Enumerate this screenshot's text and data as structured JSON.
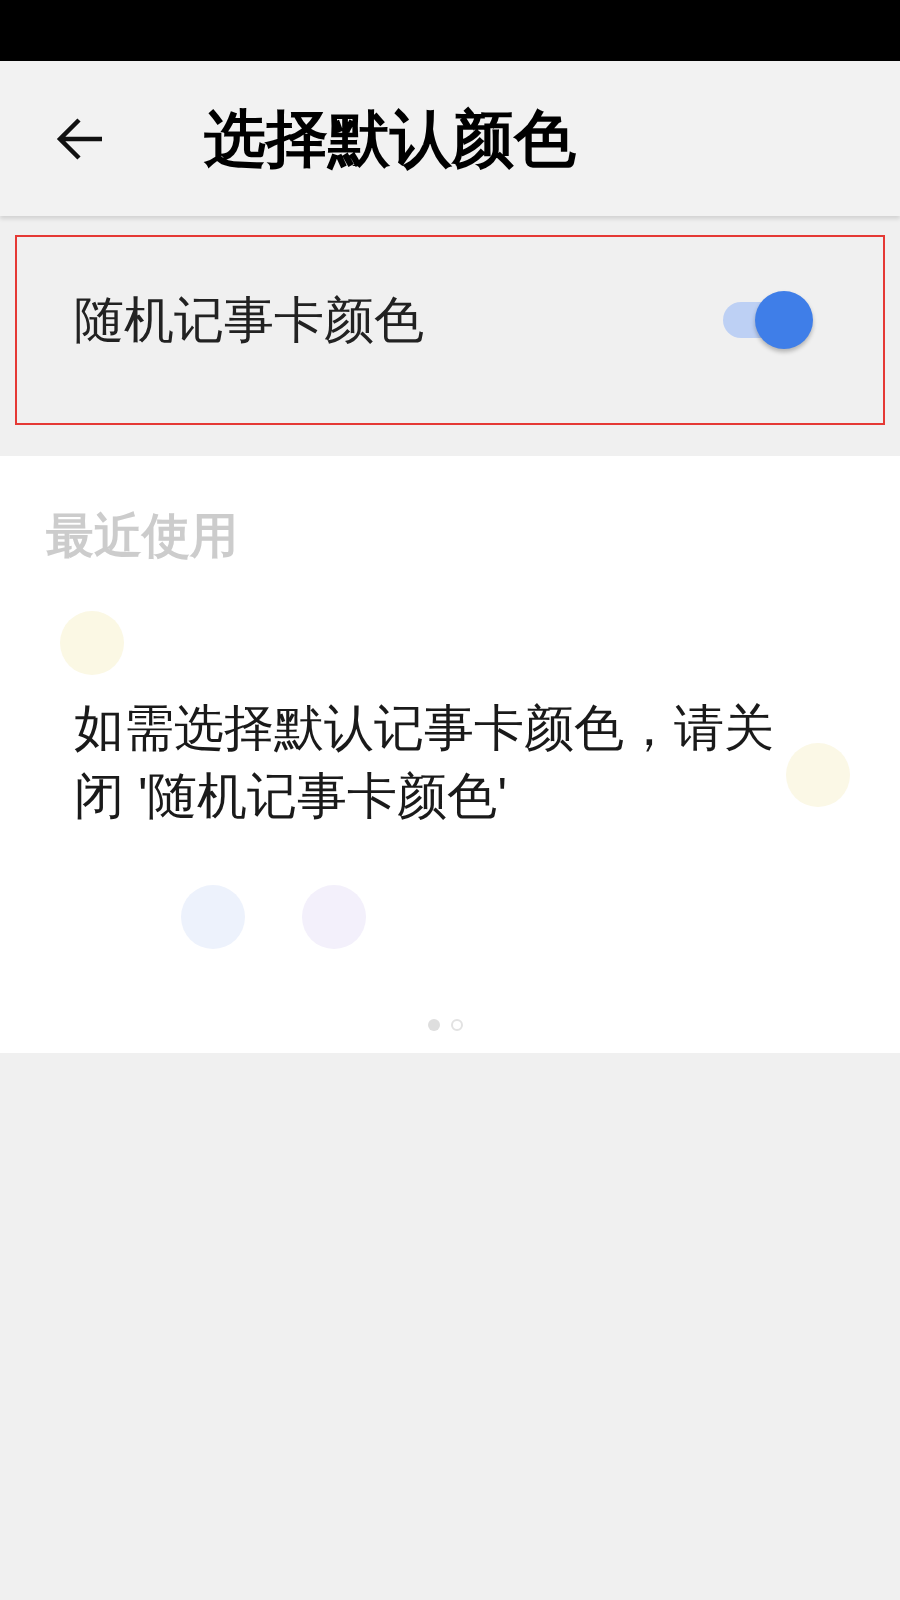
{
  "header": {
    "title": "选择默认颜色"
  },
  "random_color_setting": {
    "label": "随机记事卡颜色",
    "on": true,
    "highlighted": true
  },
  "color_panel": {
    "section_title": "最近使用",
    "recent_colors": [
      {
        "color": "#fbf8e4"
      }
    ],
    "palette_rows": [
      [
        null,
        null,
        null,
        null,
        null,
        null,
        {
          "color": "#fbf8e6"
        }
      ],
      [
        null,
        {
          "color": "#edf2fc"
        },
        {
          "color": "#f3f0fb"
        }
      ]
    ],
    "page_dots": [
      {
        "selected": true
      },
      {
        "selected": false
      }
    ],
    "overlay_message": "如需选择默认记事卡颜色，请关闭 '随机记事卡颜色'"
  }
}
